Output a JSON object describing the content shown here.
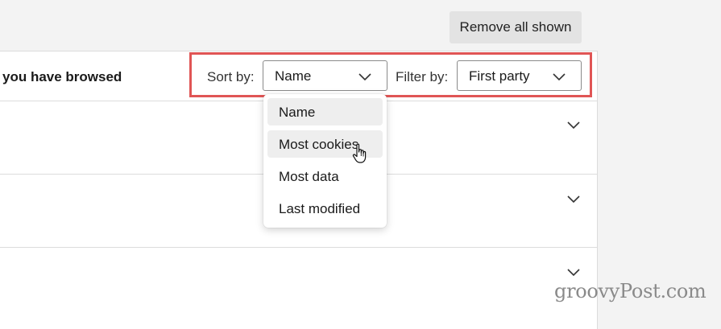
{
  "toolbar": {
    "remove_label": "Remove all shown"
  },
  "header": {
    "title": "you have browsed"
  },
  "sort": {
    "label": "Sort by:",
    "value": "Name"
  },
  "filter": {
    "label": "Filter by:",
    "value": "First party"
  },
  "sort_options": [
    "Name",
    "Most cookies",
    "Most data",
    "Last modified"
  ],
  "watermark": "groovyPost.com",
  "colors": {
    "highlight": "#e05555",
    "background": "#f3f3f3"
  }
}
